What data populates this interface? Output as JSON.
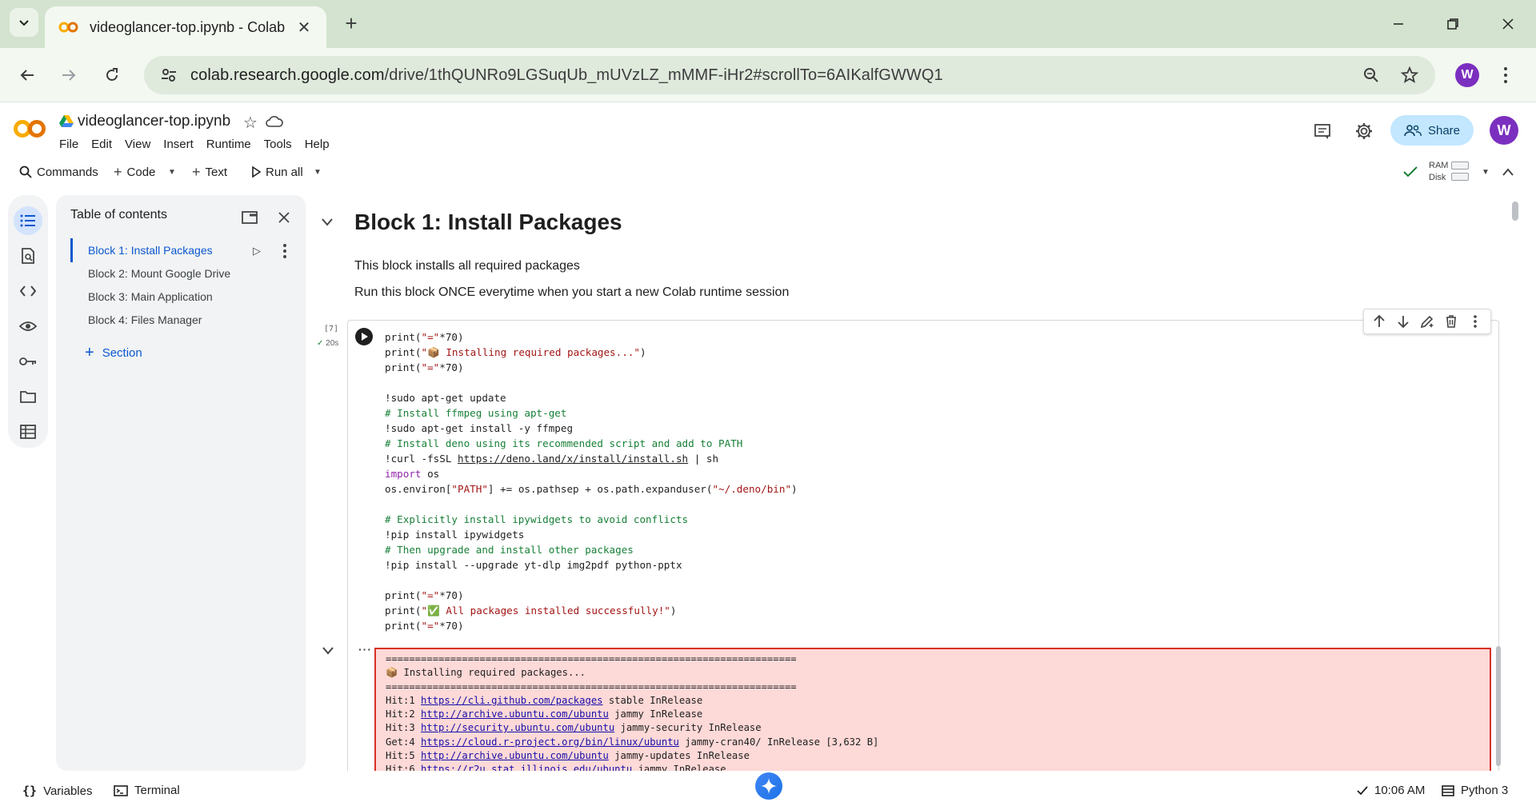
{
  "browser": {
    "tab_title": "videoglancer-top.ipynb - Colab",
    "url_host": "colab.research.google.com",
    "url_path": "/drive/1thQUNRo9LGSuqUb_mUVzLZ_mMMF-iHr2#scrollTo=6AIKalfGWWQ1",
    "profile_initial": "W"
  },
  "colab": {
    "notebook_title": "videoglancer-top.ipynb",
    "menu": [
      "File",
      "Edit",
      "View",
      "Insert",
      "Runtime",
      "Tools",
      "Help"
    ],
    "share_label": "Share",
    "avatar_initial": "W",
    "brand_color": "#f9ab00"
  },
  "commandbar": {
    "commands_label": "Commands",
    "code_label": "Code",
    "text_label": "Text",
    "run_all_label": "Run all",
    "ram_label": "RAM",
    "disk_label": "Disk"
  },
  "toc": {
    "title": "Table of contents",
    "items": [
      {
        "label": "Block 1: Install Packages",
        "active": true
      },
      {
        "label": "Block 2: Mount Google Drive",
        "active": false
      },
      {
        "label": "Block 3: Main Application",
        "active": false
      },
      {
        "label": "Block 4: Files Manager",
        "active": false
      }
    ],
    "section_label": "Section"
  },
  "main": {
    "heading": "Block 1: Install Packages",
    "desc_1": "This block installs all required packages",
    "desc_2": "Run this block ONCE everytime when you start a new Colab runtime session",
    "cell": {
      "exec_count": "[7]",
      "exec_time": "20s"
    },
    "output_lines": [
      "======================================================================",
      "📦 Installing required packages...",
      "======================================================================",
      "Hit:1 https://cli.github.com/packages stable InRelease",
      "Hit:2 http://archive.ubuntu.com/ubuntu jammy InRelease",
      "Hit:3 http://security.ubuntu.com/ubuntu jammy-security InRelease",
      "Get:4 https://cloud.r-project.org/bin/linux/ubuntu jammy-cran40/ InRelease [3,632 B]",
      "Hit:5 http://archive.ubuntu.com/ubuntu jammy-updates InRelease",
      "Hit:6 https://r2u.stat.illinois.edu/ubuntu jammy InRelease"
    ]
  },
  "statusbar": {
    "variables_label": "Variables",
    "terminal_label": "Terminal",
    "time": "10:06 AM",
    "runtime": "Python 3"
  }
}
